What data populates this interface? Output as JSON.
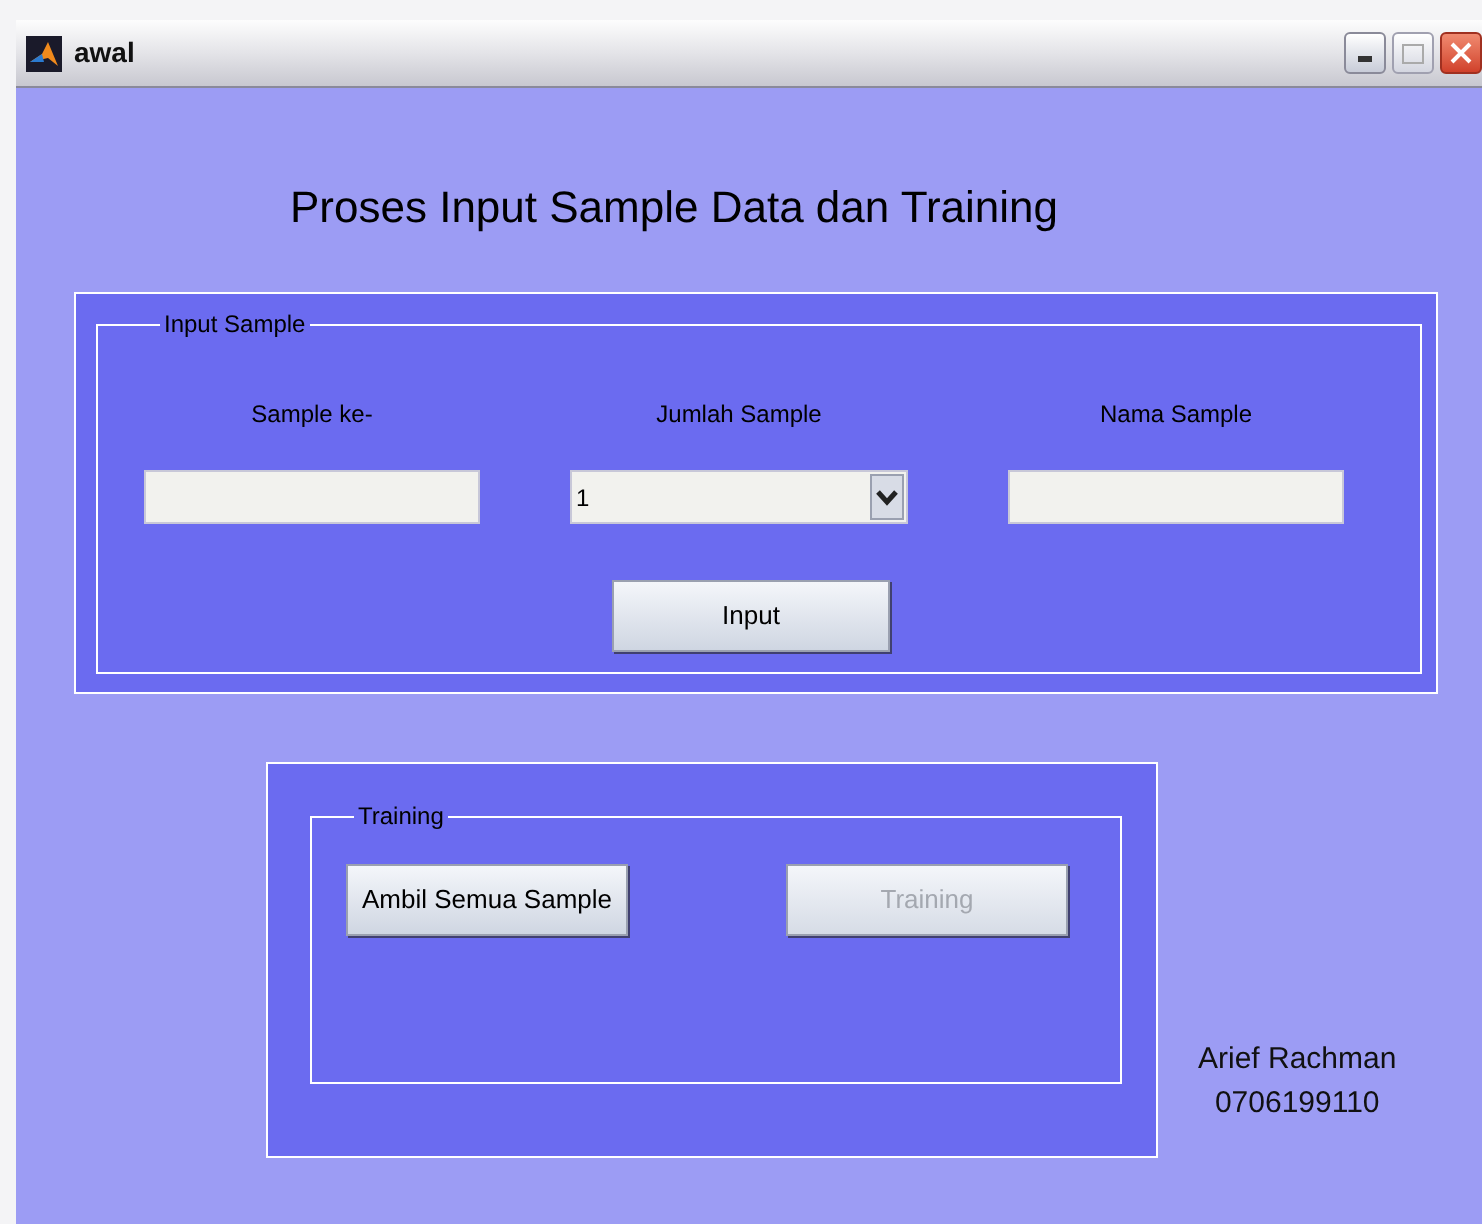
{
  "window": {
    "title": "awal"
  },
  "heading": "Proses Input Sample Data dan Training",
  "input_panel": {
    "legend": "Input Sample",
    "fields": [
      {
        "kind": "text",
        "label": "Sample ke-"
      },
      {
        "kind": "dropdown",
        "label": "Jumlah Sample",
        "value": "1"
      },
      {
        "kind": "text",
        "label": "Nama Sample"
      }
    ],
    "button": {
      "label": "Input",
      "disabled": false
    }
  },
  "training_panel": {
    "legend": "Training",
    "buttons": [
      {
        "label": "Ambil Semua Sample",
        "disabled": false
      },
      {
        "label": "Training",
        "disabled": true
      }
    ]
  },
  "author": {
    "name": "Arief Rachman",
    "id": "0706199110"
  }
}
